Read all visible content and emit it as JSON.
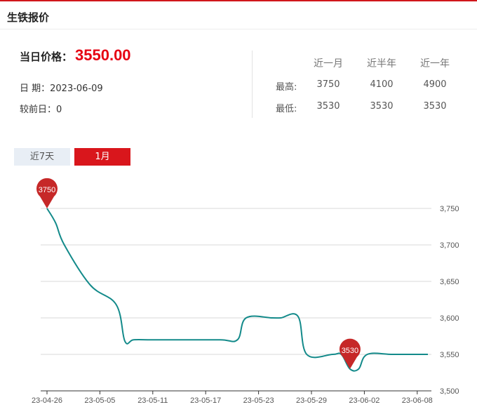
{
  "header": {
    "title": "生铁报价"
  },
  "summary": {
    "price_label": "当日价格：",
    "price_value": "3550.00",
    "date_label": "日 期：",
    "date_value": "2023-06-09",
    "change_label": "较前日：",
    "change_value": "0"
  },
  "stats": {
    "columns": [
      "近一月",
      "近半年",
      "近一年"
    ],
    "rows": [
      {
        "label": "最高:",
        "values": [
          "3750",
          "4100",
          "4900"
        ]
      },
      {
        "label": "最低:",
        "values": [
          "3530",
          "3530",
          "3530"
        ]
      }
    ]
  },
  "tabs": [
    {
      "label": "近7天",
      "active": false
    },
    {
      "label": "1月",
      "active": true
    }
  ],
  "colors": {
    "accent": "#d9161c",
    "line": "#138a8a",
    "marker": "#c62828"
  },
  "chart_data": {
    "type": "line",
    "title": "",
    "xlabel": "",
    "ylabel": "",
    "ylim": [
      3500,
      3750
    ],
    "yticks": [
      3500,
      3550,
      3600,
      3650,
      3700,
      3750
    ],
    "ytick_labels": [
      "3,500",
      "3,550",
      "3,600",
      "3,650",
      "3,700",
      "3,750"
    ],
    "xtick_labels": [
      "23-04-26",
      "23-05-05",
      "23-05-11",
      "23-05-17",
      "23-05-23",
      "23-05-29",
      "23-06-02",
      "23-06-08"
    ],
    "grid": true,
    "x": [
      "2023-04-26",
      "2023-04-27",
      "2023-04-28",
      "2023-05-01",
      "2023-05-04",
      "2023-05-05",
      "2023-05-06",
      "2023-05-08",
      "2023-05-11",
      "2023-05-16",
      "2023-05-18",
      "2023-05-19",
      "2023-05-22",
      "2023-05-23",
      "2023-05-25",
      "2023-05-26",
      "2023-05-29",
      "2023-05-30",
      "2023-05-31",
      "2023-06-01",
      "2023-06-02",
      "2023-06-05",
      "2023-06-09"
    ],
    "series": [
      {
        "values": [
          3750,
          3730,
          3700,
          3645,
          3618,
          3568,
          3570,
          3570,
          3570,
          3570,
          3570,
          3600,
          3600,
          3600,
          3602,
          3550,
          3550,
          3550,
          3530,
          3530,
          3550,
          3550,
          3550
        ]
      }
    ],
    "annotations": [
      {
        "text": "3750",
        "x": "2023-04-26",
        "y": 3750
      },
      {
        "text": "3530",
        "x": "2023-05-31",
        "y": 3530
      }
    ]
  }
}
